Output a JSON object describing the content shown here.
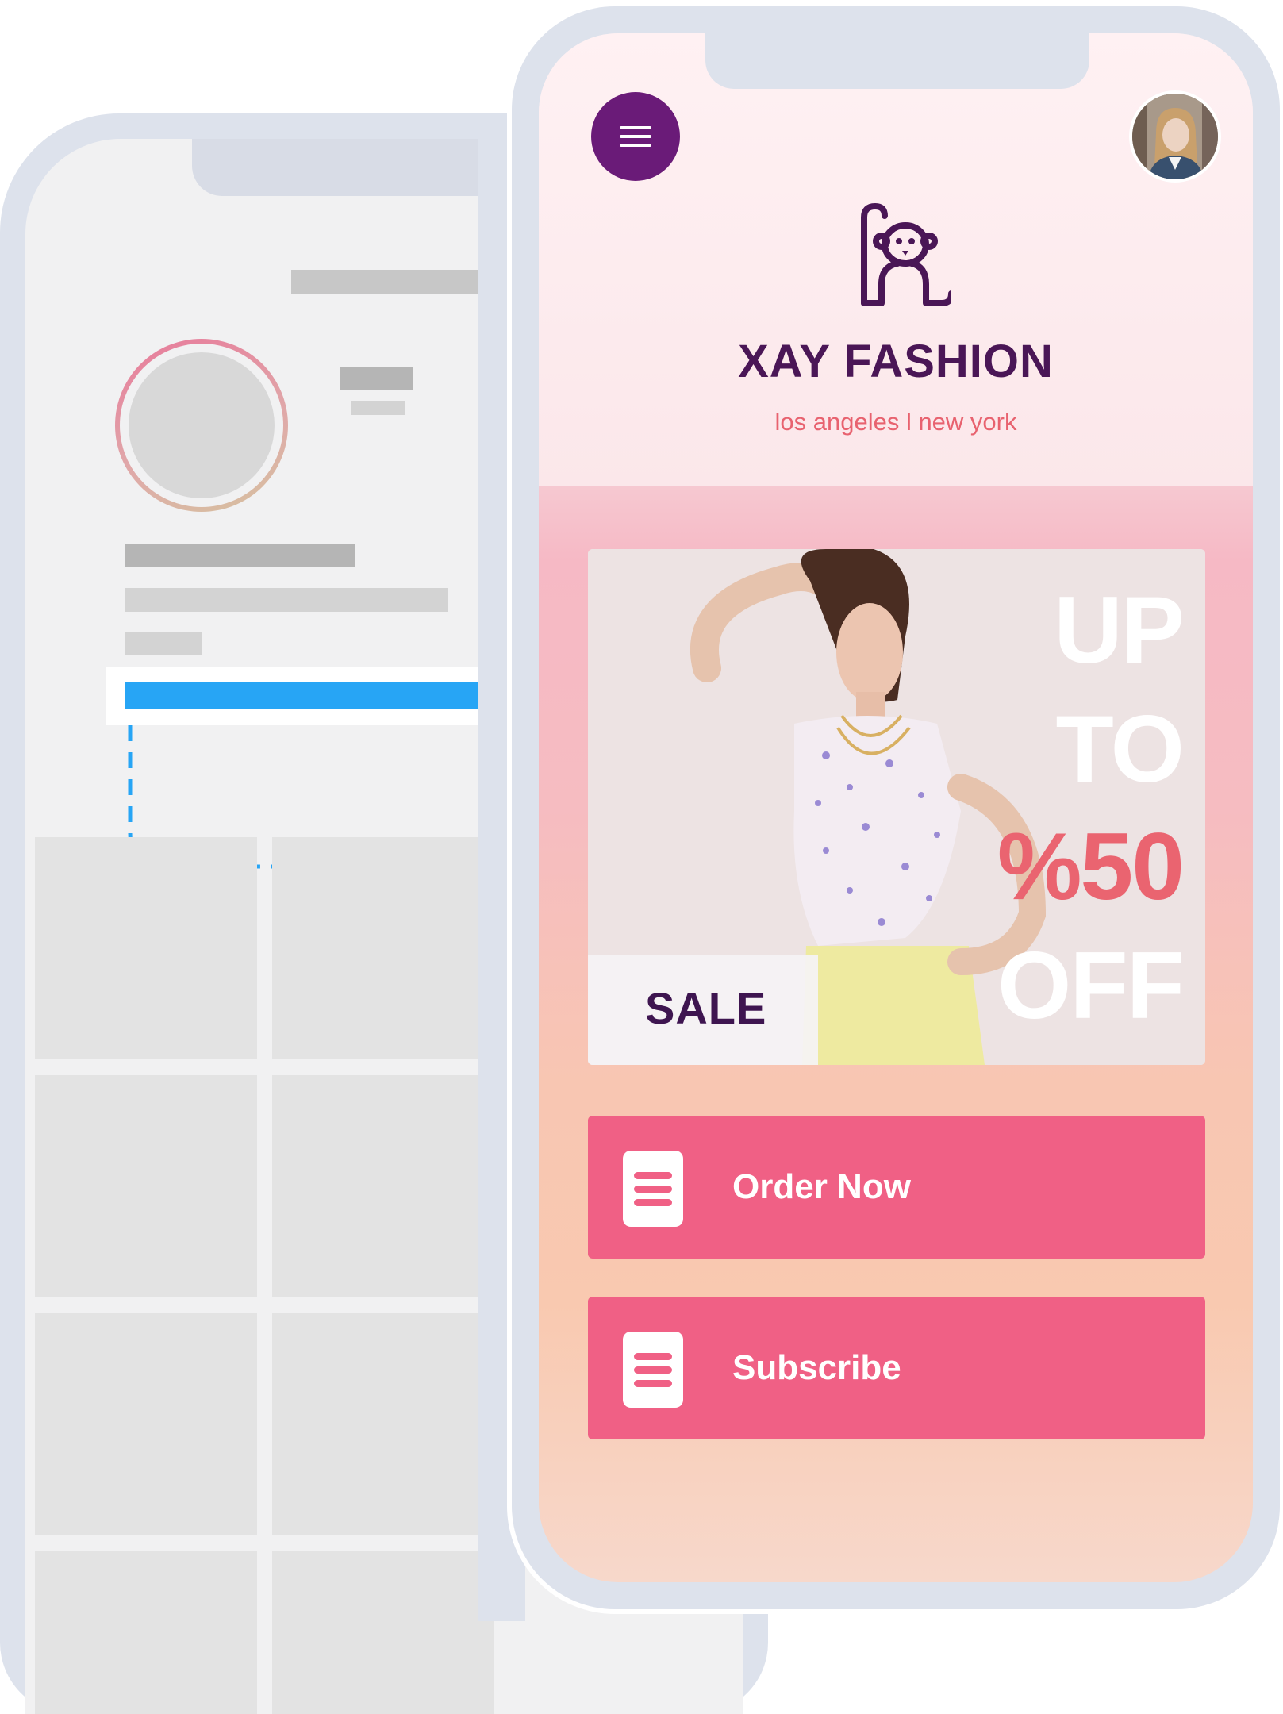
{
  "app": {
    "brand_name": "XAY FASHION",
    "brand_tagline": "los angeles l new york"
  },
  "header": {
    "menu_icon": "hamburger-menu-icon",
    "profile_icon": "user-avatar",
    "logo_icon": "monkey-logo-icon"
  },
  "promo": {
    "badge": "SALE",
    "line1": "UP",
    "line2": "TO",
    "line3": "%50",
    "line4": "OFF"
  },
  "actions": [
    {
      "label": "Order Now",
      "icon": "document-icon"
    },
    {
      "label": "Subscribe",
      "icon": "document-icon"
    }
  ],
  "colors": {
    "brand_purple": "#6a1b78",
    "title_purple": "#4a1656",
    "tagline_coral": "#e8626f",
    "cta_pink": "#f06085",
    "accent_red": "#ea6470",
    "link_blue": "#27a5f5"
  }
}
